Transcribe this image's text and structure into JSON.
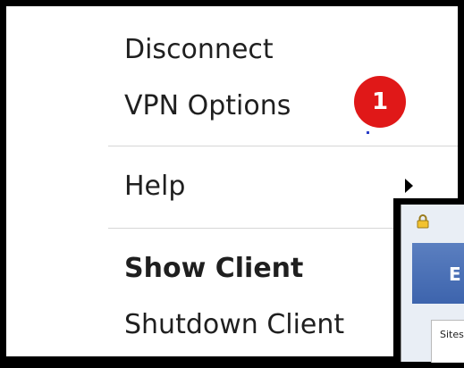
{
  "context_menu": {
    "items": [
      {
        "label": "Disconnect"
      },
      {
        "label": "VPN Options"
      },
      {
        "label": "Help"
      },
      {
        "label": "Show Client"
      },
      {
        "label": "Shutdown Client"
      }
    ]
  },
  "callout": {
    "number": "1",
    "color": "#e01818"
  },
  "background_window": {
    "banner_text": "E",
    "panel_label": "Sites",
    "icons": [
      "lock-icon"
    ]
  }
}
